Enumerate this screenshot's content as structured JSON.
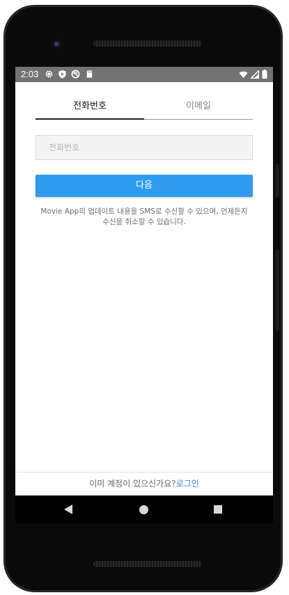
{
  "status_bar": {
    "time": "2:03",
    "left_icons": [
      "gear-icon",
      "shield-play-icon",
      "nosync-icon",
      "sdcard-icon"
    ],
    "right_icons": [
      "wifi-icon",
      "signal-icon",
      "battery-icon"
    ]
  },
  "tabs": [
    {
      "label": "전화번호",
      "active": true
    },
    {
      "label": "이메일",
      "active": false
    }
  ],
  "phone_input": {
    "value": "",
    "placeholder": "전화번호"
  },
  "next_button": {
    "label": "다음"
  },
  "notice": {
    "line1": "Movie App의 업데이트 내용을 SMS로 수신할 수 있으며, 언제든지",
    "line2": "수신을 취소할 수 있습니다."
  },
  "footer": {
    "question": "이미 계정이 있으신가요?",
    "login_label": "로그인"
  },
  "colors": {
    "accent": "#2f9bf0",
    "link": "#2f88e0",
    "status_bar": "#737373"
  }
}
